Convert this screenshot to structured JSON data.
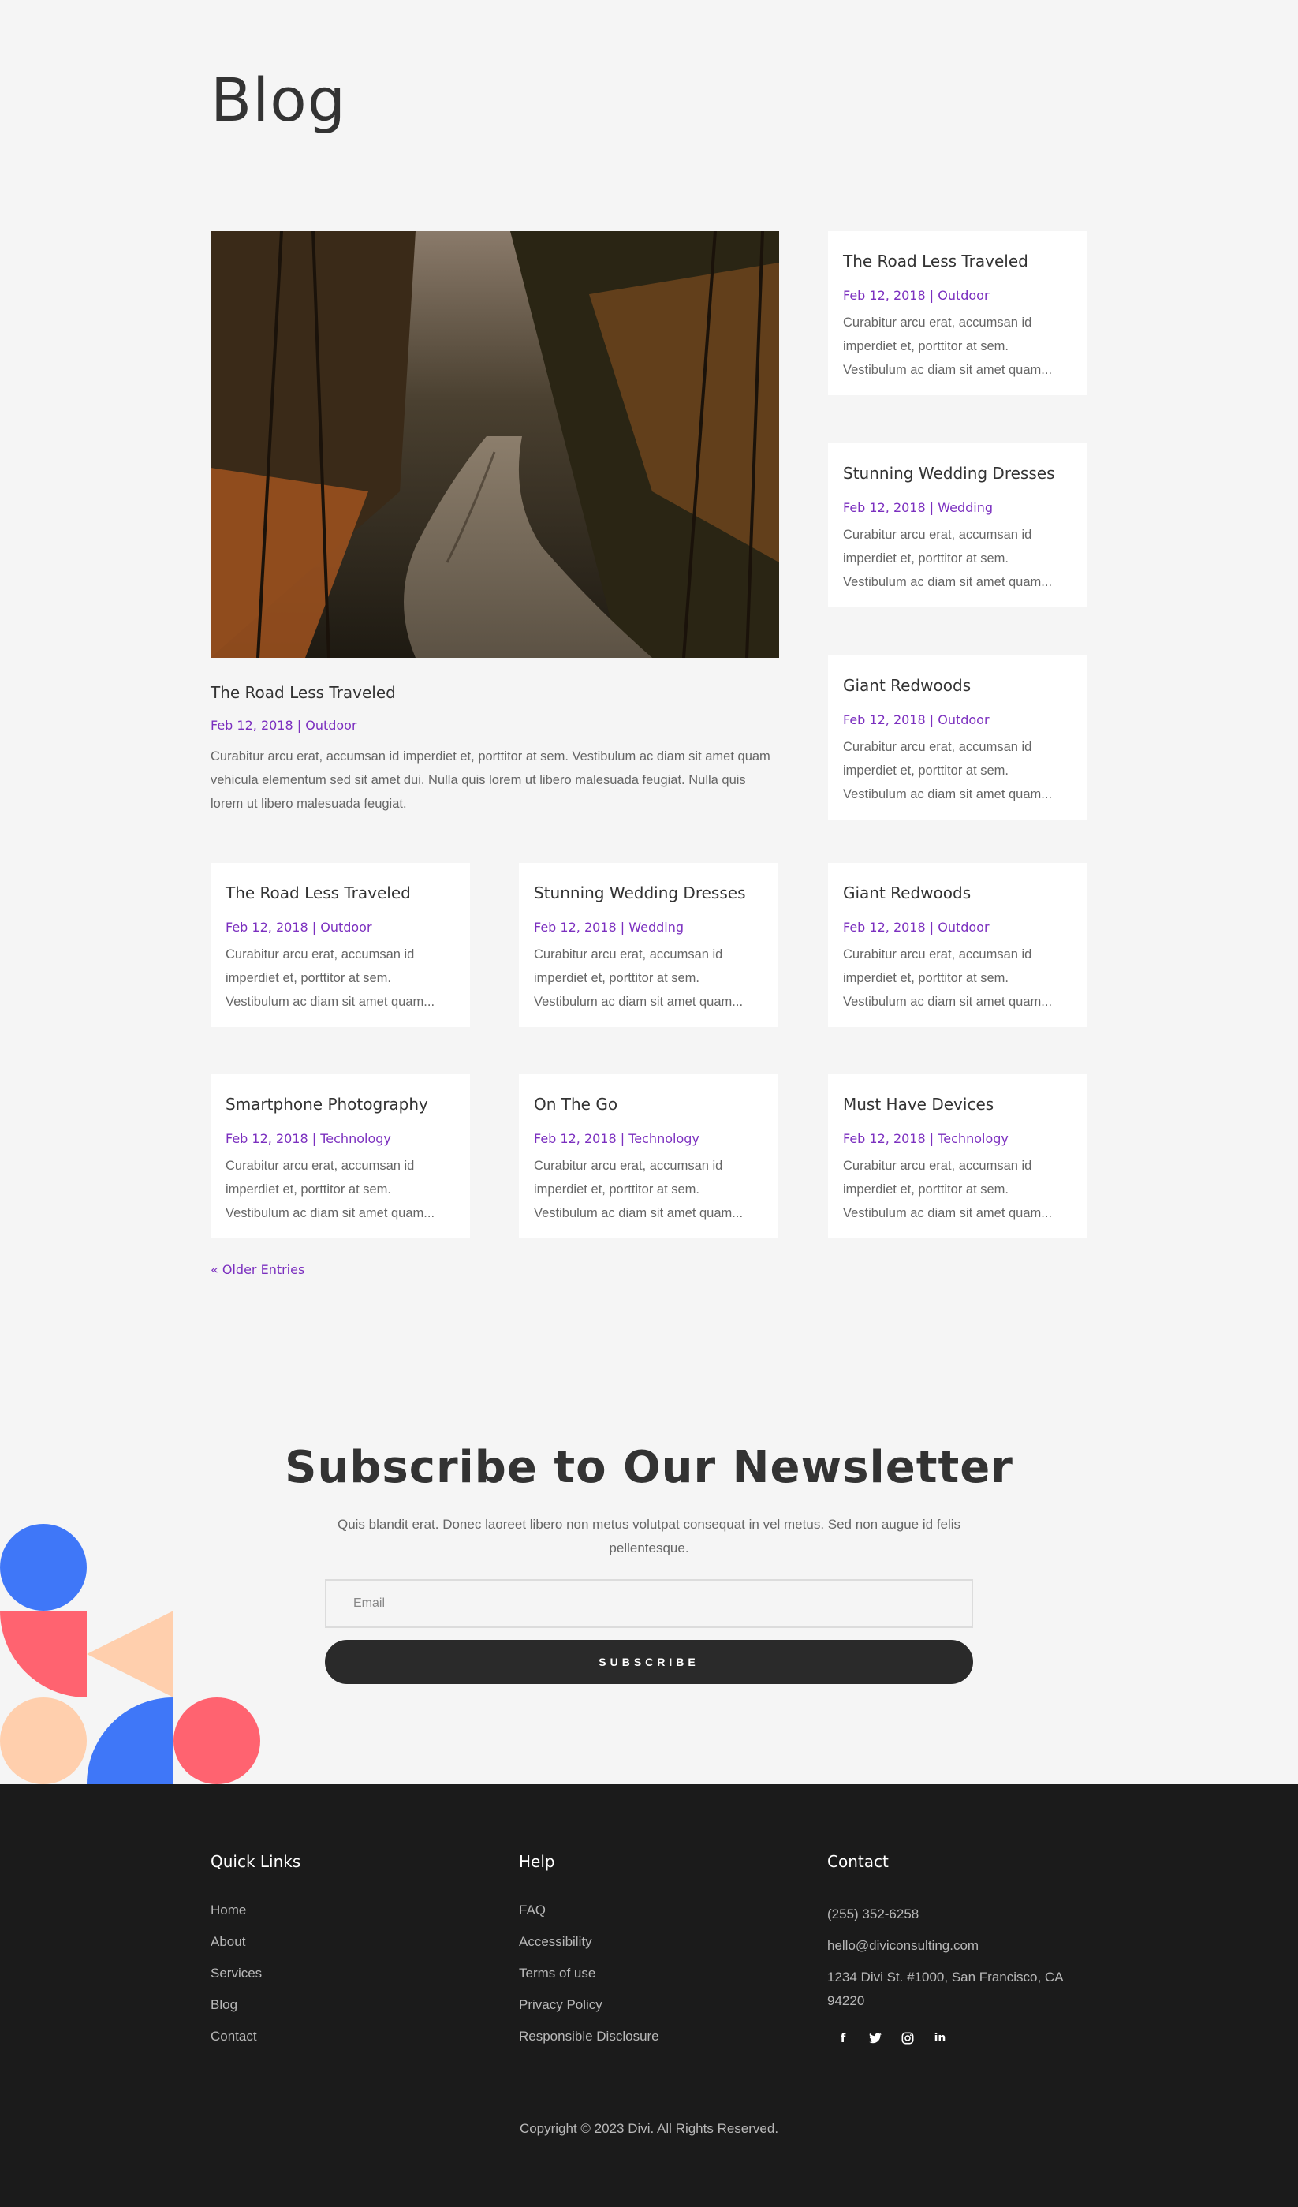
{
  "page": {
    "title": "Blog"
  },
  "featured": {
    "title": "The Road Less Traveled",
    "meta": "Feb 12, 2018 | Outdoor",
    "excerpt": "Curabitur arcu erat, accumsan id imperdiet et, porttitor at sem. Vestibulum ac diam sit amet quam vehicula elementum sed sit amet dui. Nulla quis lorem ut libero malesuada feugiat. Nulla quis lorem ut libero malesuada feugiat."
  },
  "side_posts": [
    {
      "title": "The Road Less Traveled",
      "meta": "Feb 12, 2018 | Outdoor",
      "excerpt": "Curabitur arcu erat, accumsan id imperdiet et, porttitor at sem. Vestibulum ac diam sit amet quam..."
    },
    {
      "title": "Stunning Wedding Dresses",
      "meta": "Feb 12, 2018 | Wedding",
      "excerpt": "Curabitur arcu erat, accumsan id imperdiet et, porttitor at sem. Vestibulum ac diam sit amet quam..."
    },
    {
      "title": "Giant Redwoods",
      "meta": "Feb 12, 2018 | Outdoor",
      "excerpt": "Curabitur arcu erat, accumsan id imperdiet et, porttitor at sem. Vestibulum ac diam sit amet quam..."
    }
  ],
  "grid_posts": [
    {
      "title": "The Road Less Traveled",
      "meta": "Feb 12, 2018 | Outdoor",
      "excerpt": "Curabitur arcu erat, accumsan id imperdiet et, porttitor at sem. Vestibulum ac diam sit amet quam..."
    },
    {
      "title": "Stunning Wedding Dresses",
      "meta": "Feb 12, 2018 | Wedding",
      "excerpt": "Curabitur arcu erat, accumsan id imperdiet et, porttitor at sem. Vestibulum ac diam sit amet quam..."
    },
    {
      "title": "Giant Redwoods",
      "meta": "Feb 12, 2018 | Outdoor",
      "excerpt": "Curabitur arcu erat, accumsan id imperdiet et, porttitor at sem. Vestibulum ac diam sit amet quam..."
    },
    {
      "title": "Smartphone Photography",
      "meta": "Feb 12, 2018 | Technology",
      "excerpt": "Curabitur arcu erat, accumsan id imperdiet et, porttitor at sem. Vestibulum ac diam sit amet quam..."
    },
    {
      "title": "On The Go",
      "meta": "Feb 12, 2018 | Technology",
      "excerpt": "Curabitur arcu erat, accumsan id imperdiet et, porttitor at sem. Vestibulum ac diam sit amet quam..."
    },
    {
      "title": "Must Have Devices",
      "meta": "Feb 12, 2018 | Technology",
      "excerpt": "Curabitur arcu erat, accumsan id imperdiet et, porttitor at sem. Vestibulum ac diam sit amet quam..."
    }
  ],
  "pagination": {
    "older_label": "« Older Entries"
  },
  "newsletter": {
    "title": "Subscribe to Our Newsletter",
    "text": "Quis blandit erat. Donec laoreet libero non metus volutpat consequat in vel metus. Sed non augue id felis pellentesque.",
    "email_placeholder": "Email",
    "button_label": "SUBSCRIBE"
  },
  "footer": {
    "quick_links": {
      "heading": "Quick Links",
      "items": [
        "Home",
        "About",
        "Services",
        "Blog",
        "Contact"
      ]
    },
    "help": {
      "heading": "Help",
      "items": [
        "FAQ",
        "Accessibility",
        "Terms of use",
        "Privacy Policy",
        "Responsible Disclosure"
      ]
    },
    "contact": {
      "heading": "Contact",
      "phone": "(255) 352-6258",
      "email": "hello@diviconsulting.com",
      "address": "1234 Divi St. #1000, San Francisco, CA 94220"
    },
    "social_icons": [
      "facebook-icon",
      "twitter-icon",
      "instagram-icon",
      "linkedin-icon"
    ],
    "copyright": "Copyright © 2023 Divi. All Rights Reserved."
  },
  "colors": {
    "accent": "#7b2fbf",
    "background": "#f5f5f5",
    "footer_bg": "#1b1b1b",
    "button_bg": "#2a2a2a",
    "shape_blue": "#3f77f8",
    "shape_red": "#ff6370",
    "shape_peach": "#ffcfad"
  }
}
